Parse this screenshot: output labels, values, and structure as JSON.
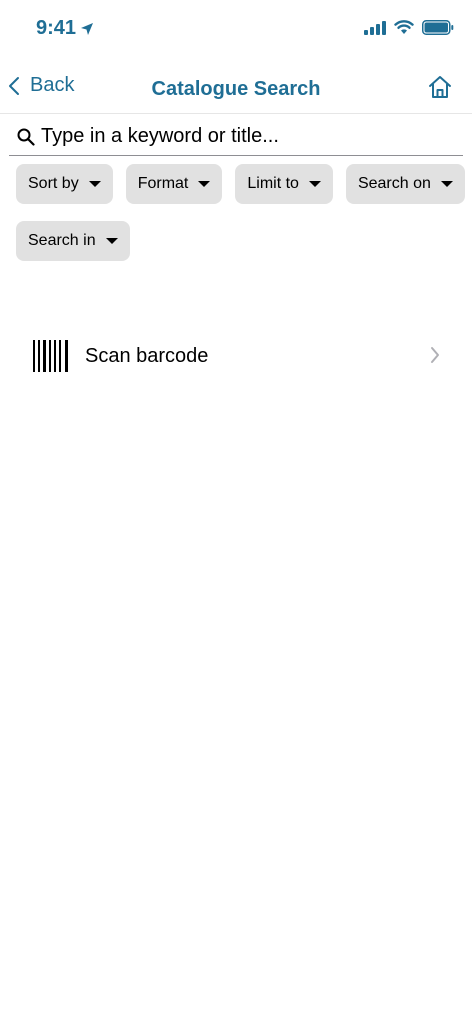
{
  "status_bar": {
    "time": "9:41",
    "accent_color": "#1f6e95",
    "icons": [
      "location-arrow-icon",
      "signal-icon",
      "wifi-icon",
      "battery-icon"
    ]
  },
  "nav": {
    "back_label": "Back",
    "title": "Catalogue Search",
    "home_icon": "home-icon"
  },
  "search": {
    "placeholder": "Type in a keyword or title...",
    "value": ""
  },
  "filters": {
    "row1": [
      "Sort by",
      "Format",
      "Limit to",
      "Search on"
    ],
    "row2": [
      "Search in"
    ]
  },
  "scan": {
    "label": "Scan barcode",
    "icon": "barcode-icon"
  }
}
